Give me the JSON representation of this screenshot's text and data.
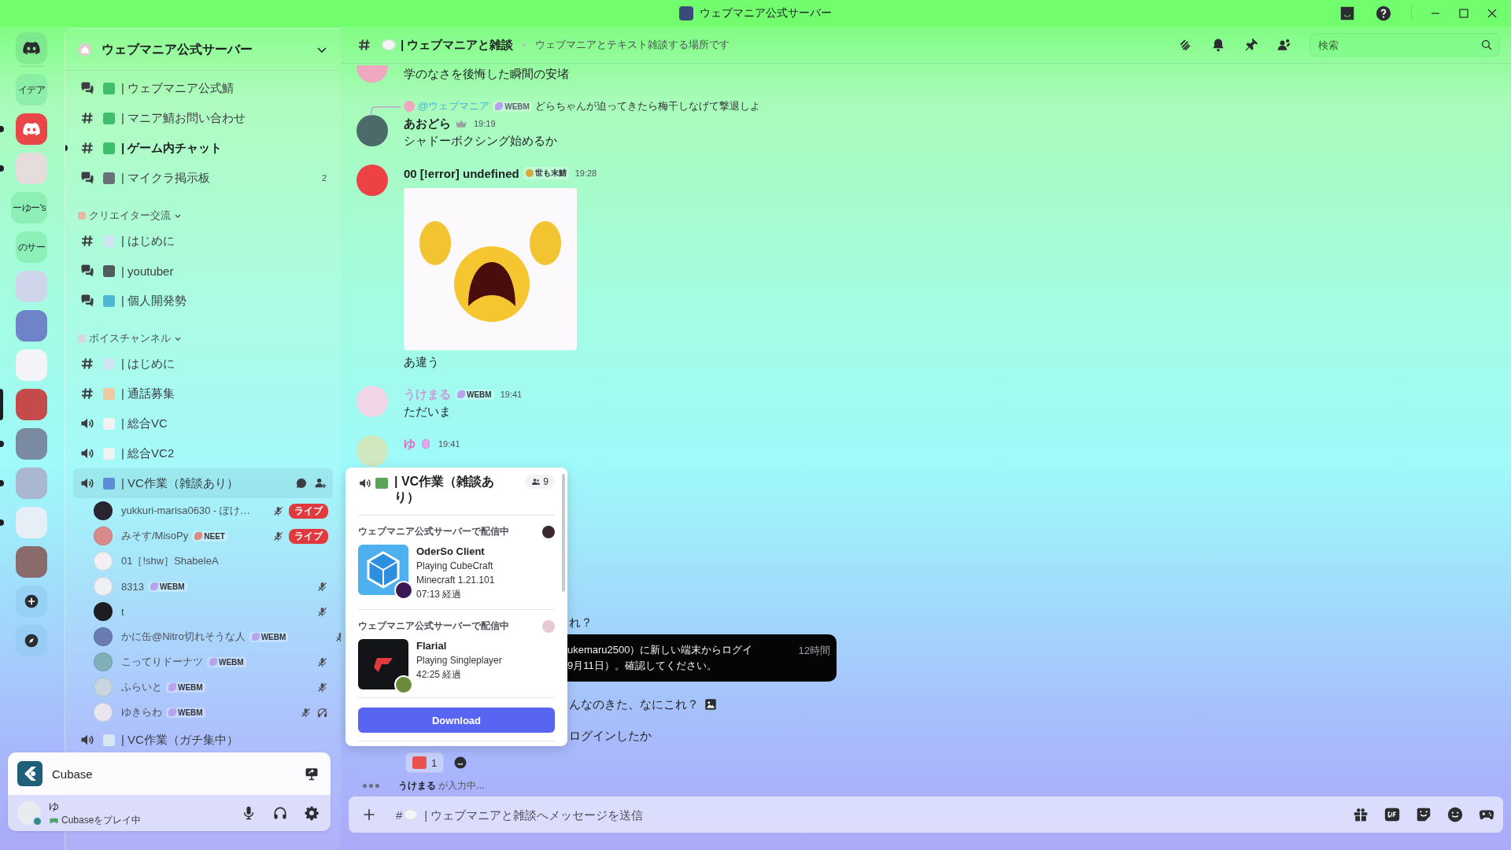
{
  "window": {
    "title": "ウェブマニア公式サーバー"
  },
  "servers": [
    {
      "kind": "home",
      "selected": false,
      "unread": false
    },
    {
      "kind": "text",
      "label": "イデア",
      "selected": false,
      "unread": false
    },
    {
      "kind": "logo",
      "selected": false,
      "unread": true
    },
    {
      "kind": "photo",
      "selected": false,
      "unread": true
    },
    {
      "kind": "text",
      "label": "ーゆー's",
      "selected": false,
      "unread": false
    },
    {
      "kind": "text",
      "label": "のサー",
      "selected": false,
      "unread": false
    },
    {
      "kind": "photo",
      "selected": false,
      "unread": false
    },
    {
      "kind": "photo",
      "selected": false,
      "unread": false
    },
    {
      "kind": "photo",
      "selected": false,
      "unread": false
    },
    {
      "kind": "photo",
      "selected": true,
      "unread": false
    },
    {
      "kind": "photo",
      "selected": false,
      "unread": true
    },
    {
      "kind": "photo",
      "selected": false,
      "unread": true
    },
    {
      "kind": "photo",
      "selected": false,
      "unread": true
    },
    {
      "kind": "photo",
      "selected": false,
      "unread": false
    },
    {
      "kind": "add",
      "selected": false,
      "unread": false
    },
    {
      "kind": "explore",
      "selected": false,
      "unread": false
    }
  ],
  "server_header": {
    "name": "ウェブマニア公式サーバー"
  },
  "channels": [
    {
      "kind": "forum",
      "name": "| ウェブマニア公式鯖",
      "unread": false,
      "selected": false
    },
    {
      "kind": "text",
      "name": "| マニア鯖お問い合わせ",
      "unread": false,
      "selected": false
    },
    {
      "kind": "text",
      "name": "| ゲーム内チャット",
      "unread": true,
      "selected": false
    },
    {
      "kind": "forum",
      "name": "| マイクラ掲示板",
      "unread": false,
      "selected": false,
      "badge": "2"
    },
    {
      "kind": "category",
      "name": "クリエイター交流"
    },
    {
      "kind": "text",
      "name": "| はじめに",
      "unread": false,
      "selected": false
    },
    {
      "kind": "forum",
      "name": "| youtuber",
      "unread": false,
      "selected": false
    },
    {
      "kind": "forum",
      "name": "| 個人開発勢",
      "unread": false,
      "selected": false
    },
    {
      "kind": "category",
      "name": "ボイスチャンネル"
    },
    {
      "kind": "text",
      "name": "| はじめに",
      "unread": false,
      "selected": false
    },
    {
      "kind": "text",
      "name": "| 通話募集",
      "unread": false,
      "selected": false
    },
    {
      "kind": "voice",
      "name": "| 総合VC",
      "unread": false,
      "selected": false
    },
    {
      "kind": "voice",
      "name": "| 総合VC2",
      "unread": false,
      "selected": false
    },
    {
      "kind": "voice",
      "name": "| VC作業（雑談あり）",
      "unread": false,
      "selected": true,
      "users": [
        {
          "name": "yukkuri-marisa0630 - ぽけ…",
          "muted": true,
          "deafened": false,
          "live": "ライブ"
        },
        {
          "name": "みそす/MisoPy",
          "tag": "NEET",
          "muted": true,
          "deafened": false,
          "live": "ライブ"
        },
        {
          "name": "01［!shw］ShabeleA",
          "muted": false,
          "deafened": false
        },
        {
          "name": "8313",
          "tag": "WEBM",
          "muted": true,
          "deafened": false
        },
        {
          "name": "t",
          "muted": true,
          "deafened": false
        },
        {
          "name": "かに缶@Nitro切れそうな人",
          "tag": "WEBM",
          "muted": true,
          "deafened": false
        },
        {
          "name": "こってりドーナツ",
          "tag": "WEBM",
          "muted": true,
          "deafened": false
        },
        {
          "name": "ふらいと",
          "tag": "WEBM",
          "muted": true,
          "deafened": false
        },
        {
          "name": "ゆきらわ",
          "tag": "WEBM",
          "muted": true,
          "deafened": true
        }
      ]
    },
    {
      "kind": "voice",
      "name": "| VC作業（ガチ集中）",
      "unread": false,
      "selected": false
    }
  ],
  "activity": {
    "name": "Cubase"
  },
  "user": {
    "name": "ゆ",
    "status": "Cubaseをプレイ中"
  },
  "chat_header": {
    "channel": "| ウェブマニアと雑談",
    "topic": "ウェブマニアとテキスト雑談する場所です",
    "search": {
      "placeholder": "検索"
    }
  },
  "messages": [
    {
      "kind": "continued",
      "text": "学のなさを後悔した瞬間の安堵"
    },
    {
      "kind": "message",
      "author": "あおどら",
      "color": "#1e1f22",
      "time": "19:19",
      "reply": {
        "author": "@ウェブマニア",
        "color": "#3fb7d6",
        "tag": "WEBM",
        "text": "どらちゃんが迫ってきたら梅干しなげて撃退しよ"
      },
      "text": "シャドーボクシング始めるか"
    },
    {
      "kind": "message",
      "author": "00 [!error] undefined",
      "color": "#1e1f22",
      "tag": "世も末鯖",
      "time": "19:28",
      "image": true,
      "text": "あ違う"
    },
    {
      "kind": "message",
      "author": "うけまる",
      "color": "#c99ad8",
      "tag": "WEBM",
      "time": "19:41",
      "text": "ただいま"
    },
    {
      "kind": "message",
      "author": "ゆ",
      "color": "#e468c4",
      "time": "19:41"
    },
    {
      "kind": "fragment",
      "text": "れ？"
    },
    {
      "kind": "notice",
      "lines": [
        "ukemaru2500）に新しい端末からログイ",
        "9月11日）。確認してください。"
      ],
      "time": "12時間"
    },
    {
      "kind": "fragment",
      "text": "んなのきた、なにこれ？",
      "attachment": true
    },
    {
      "kind": "fragment",
      "text": "ログインしたか"
    },
    {
      "kind": "reactions",
      "count": "1"
    }
  ],
  "typing": {
    "user": "うけまる",
    "text": "が入力中..."
  },
  "composer": {
    "prefix": "#",
    "placeholder": "| ウェブマニアと雑談へメッセージを送信"
  },
  "voice_popup": {
    "title": "| VC作業（雑談あり）",
    "count": "9",
    "streams": [
      {
        "server": "ウェブマニア公式サーバーで配信中",
        "name": "OderSo Client",
        "details": [
          "Playing CubeCraft",
          "Minecraft 1.21.101"
        ],
        "elapsed": "07:13 経過"
      },
      {
        "server": "ウェブマニア公式サーバーで配信中",
        "name": "Flarial",
        "details": [
          "Playing Singleplayer"
        ],
        "elapsed": "42:25 経過"
      }
    ],
    "button": "Download"
  }
}
